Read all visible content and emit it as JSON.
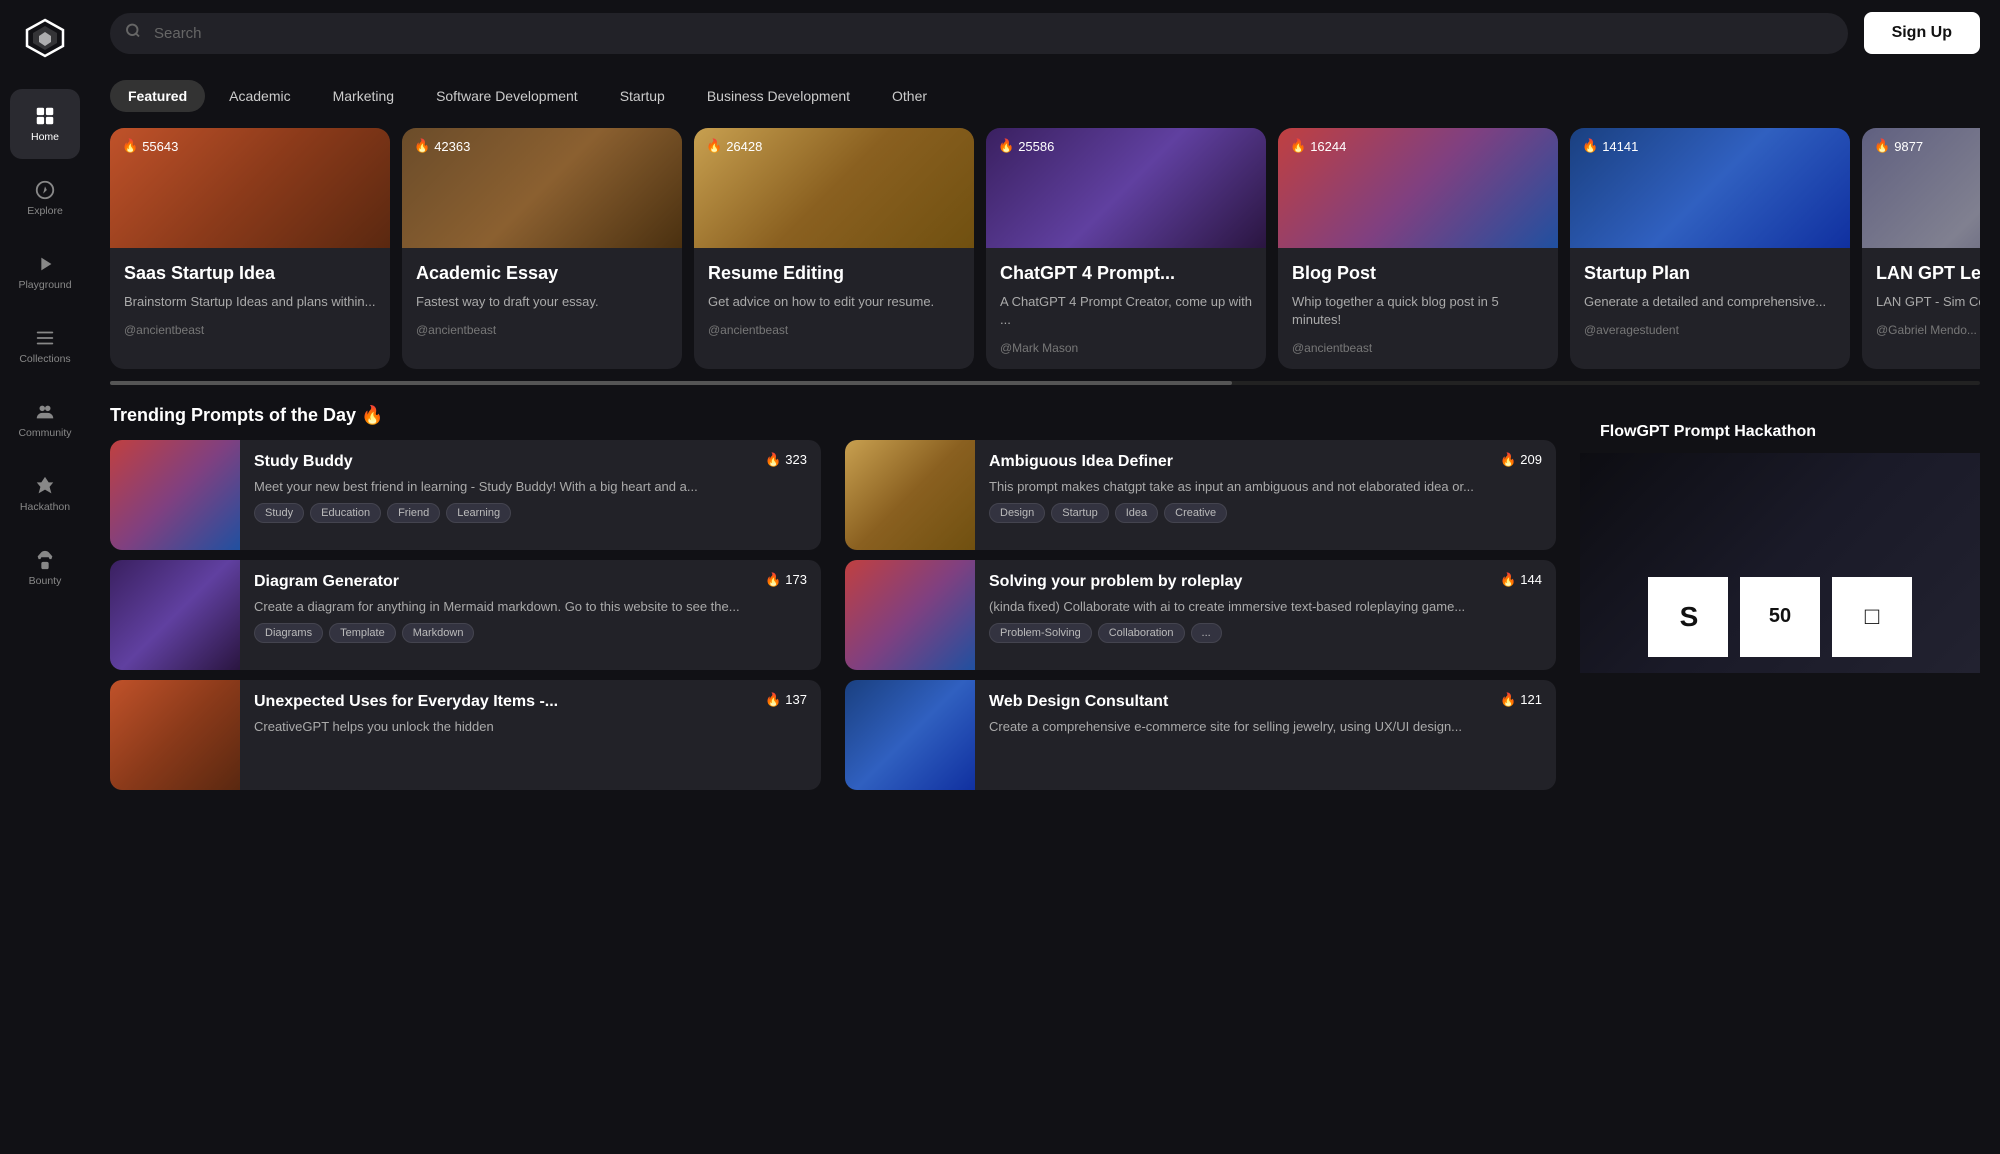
{
  "sidebar": {
    "logo_alt": "FlowGPT Logo",
    "items": [
      {
        "id": "home",
        "label": "Home",
        "active": true
      },
      {
        "id": "explore",
        "label": "Explore",
        "active": false
      },
      {
        "id": "playground",
        "label": "Playground",
        "active": false
      },
      {
        "id": "collections",
        "label": "Collections",
        "active": false
      },
      {
        "id": "community",
        "label": "Community",
        "active": false
      },
      {
        "id": "hackathon",
        "label": "Hackathon",
        "active": false
      },
      {
        "id": "bounty",
        "label": "Bounty",
        "active": false
      }
    ]
  },
  "header": {
    "search_placeholder": "Search",
    "signup_label": "Sign Up"
  },
  "categories": [
    {
      "id": "featured",
      "label": "Featured",
      "active": true
    },
    {
      "id": "academic",
      "label": "Academic",
      "active": false
    },
    {
      "id": "marketing",
      "label": "Marketing",
      "active": false
    },
    {
      "id": "software-dev",
      "label": "Software Development",
      "active": false
    },
    {
      "id": "startup",
      "label": "Startup",
      "active": false
    },
    {
      "id": "business-dev",
      "label": "Business Development",
      "active": false
    },
    {
      "id": "other",
      "label": "Other",
      "active": false
    }
  ],
  "featured_cards": [
    {
      "id": "saas-startup",
      "title": "Saas Startup Idea",
      "description": "Brainstorm Startup Ideas and plans within...",
      "author": "@ancientbeast",
      "count": "55643",
      "bg": "bg-orange"
    },
    {
      "id": "academic-essay",
      "title": "Academic Essay",
      "description": "Fastest way to draft your essay.",
      "author": "@ancientbeast",
      "count": "42363",
      "bg": "bg-brown"
    },
    {
      "id": "resume-editing",
      "title": "Resume Editing",
      "description": "Get advice on how to edit your resume.",
      "author": "@ancientbeast",
      "count": "26428",
      "bg": "bg-gold"
    },
    {
      "id": "chatgpt4",
      "title": "ChatGPT 4 Prompt...",
      "description": "A ChatGPT 4 Prompt Creator, come up with ...",
      "author": "@Mark Mason",
      "count": "25586",
      "bg": "bg-purple"
    },
    {
      "id": "blog-post",
      "title": "Blog Post",
      "description": "Whip together a quick blog post in 5 minutes!",
      "author": "@ancientbeast",
      "count": "16244",
      "bg": "bg-sunset"
    },
    {
      "id": "startup-plan",
      "title": "Startup Plan",
      "description": "Generate a detailed and comprehensive...",
      "author": "@averagestudent",
      "count": "14141",
      "bg": "bg-blue"
    },
    {
      "id": "lan-gpt",
      "title": "LAN GPT Learn...",
      "description": "LAN GPT - Sim Complicated C",
      "author": "@Gabriel Mendo...",
      "count": "9877",
      "bg": "bg-gray"
    }
  ],
  "trending": {
    "section_title": "Trending Prompts of the Day 🔥",
    "cards": [
      {
        "id": "study-buddy",
        "title": "Study Buddy",
        "description": "Meet your new best friend in learning - Study Buddy! With a big heart and a...",
        "count": "323",
        "tags": [
          "Study",
          "Education",
          "Friend",
          "Learning"
        ],
        "bg": "bg-sunset"
      },
      {
        "id": "diagram-generator",
        "title": "Diagram Generator",
        "description": "Create a diagram for anything in Mermaid markdown. Go to this website to see the...",
        "count": "173",
        "tags": [
          "Diagrams",
          "Template",
          "Markdown"
        ],
        "bg": "bg-purple"
      },
      {
        "id": "unexpected-uses",
        "title": "Unexpected Uses for Everyday Items -...",
        "description": "CreativeGPT helps you unlock the hidden",
        "count": "137",
        "tags": [],
        "bg": "bg-orange"
      }
    ],
    "cards_right": [
      {
        "id": "ambiguous-idea",
        "title": "Ambiguous Idea Definer",
        "description": "This prompt makes chatgpt take as input an ambiguous and not elaborated idea or...",
        "count": "209",
        "tags": [
          "Design",
          "Startup",
          "Idea",
          "Creative"
        ],
        "bg": "bg-gold"
      },
      {
        "id": "solving-roleplay",
        "title": "Solving your problem by roleplay",
        "description": "(kinda fixed) Collaborate with ai to create immersive text-based roleplaying game...",
        "count": "144",
        "tags": [
          "Problem-Solving",
          "Collaboration",
          "..."
        ],
        "bg": "bg-sunset"
      },
      {
        "id": "web-design",
        "title": "Web Design Consultant",
        "description": "Create a comprehensive e-commerce site for selling jewelry, using UX/UI design...",
        "count": "121",
        "tags": [],
        "bg": "bg-blue"
      }
    ]
  },
  "hackathon": {
    "title": "FlowGPT Prompt Hackathon"
  },
  "icons": {
    "search": "🔍",
    "home": "⊞",
    "explore": "🧭",
    "playground": "▶",
    "collections": "☰",
    "community": "👥",
    "hackathon": "🚀",
    "bounty": "👑",
    "fire": "🔥"
  }
}
